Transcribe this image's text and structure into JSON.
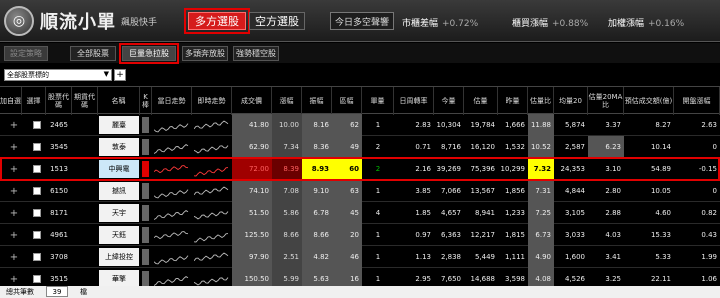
{
  "app": {
    "logo_text": "順流小單",
    "logo_sub": "飆股快手",
    "logo_icon": "logo-icon"
  },
  "modes": {
    "long": "多方選股",
    "short": "空方選股"
  },
  "today_button": "今日多空聲響",
  "market": [
    {
      "label": "市櫃差幅",
      "value": "+0.72%"
    },
    {
      "label": "櫃買漲幅",
      "value": "+0.88%"
    },
    {
      "label": "加權漲幅",
      "value": "+0.16%"
    }
  ],
  "tabs": {
    "settings": "設定策略",
    "all": "全部股票",
    "volume": "巨量急拉股",
    "rebound": "多頭奔放股",
    "weak": "強勢穩空股"
  },
  "filter": {
    "selected": "全部股票標的",
    "add": "+"
  },
  "columns": {
    "add": "加自選",
    "check": "選擇",
    "code": "股票代碼",
    "period": "期貨代碼",
    "name": "名稱",
    "bar": "K棒",
    "trend_daily": "當日走勢",
    "trend_recent": "即時走勢",
    "price": "成交價",
    "change": "漲幅",
    "amplitude": "振幅",
    "range": "區幅",
    "count": "單量",
    "turnover": "日周轉率",
    "vol_today": "今量",
    "vol_est": "估量",
    "vol_yday": "昨量",
    "ratio": "估量比",
    "ma20": "均量20",
    "ratio20": "估量20MA比",
    "deal_est": "預估成交額(億)",
    "open_change": "開盤漲幅"
  },
  "rows": [
    {
      "plus": "+",
      "code": "2465",
      "name": "麗臺",
      "price": "41.80",
      "change": "10.00",
      "amp": "8.16",
      "range": "62",
      "count": "1",
      "turnover": "2.83",
      "vol": "10,304",
      "est": "19,784",
      "yday": "1,666",
      "ratio": "11.88",
      "ma20": "5,874",
      "r20": "3.37",
      "deal": "8.27",
      "open": "2.63"
    },
    {
      "plus": "+",
      "code": "3545",
      "name": "敦泰",
      "price": "62.90",
      "change": "7.34",
      "amp": "8.36",
      "range": "49",
      "count": "2",
      "turnover": "0.71",
      "vol": "8,716",
      "est": "16,120",
      "yday": "1,532",
      "ratio": "10.52",
      "ma20": "2,587",
      "r20": "6.23",
      "deal": "10.14",
      "open": "0"
    },
    {
      "plus": "+",
      "code": "1513",
      "name": "中興電",
      "price": "72.00",
      "change": "8.39",
      "amp": "8.93",
      "range": "60",
      "count": "2",
      "turnover": "2.16",
      "vol": "39,269",
      "est": "75,396",
      "yday": "10,299",
      "ratio": "7.32",
      "ma20": "24,353",
      "r20": "3.10",
      "deal": "54.89",
      "open": "-0.15"
    },
    {
      "plus": "+",
      "code": "6150",
      "name": "撼訊",
      "price": "74.10",
      "change": "7.08",
      "amp": "9.10",
      "range": "63",
      "count": "1",
      "turnover": "3.85",
      "vol": "7,066",
      "est": "13,567",
      "yday": "1,856",
      "ratio": "7.31",
      "ma20": "4,844",
      "r20": "2.80",
      "deal": "10.05",
      "open": "0"
    },
    {
      "plus": "+",
      "code": "8171",
      "name": "天宇",
      "price": "51.50",
      "change": "5.86",
      "amp": "6.78",
      "range": "45",
      "count": "4",
      "turnover": "1.85",
      "vol": "4,657",
      "est": "8,941",
      "yday": "1,233",
      "ratio": "7.25",
      "ma20": "3,105",
      "r20": "2.88",
      "deal": "4.60",
      "open": "0.82"
    },
    {
      "plus": "+",
      "code": "4961",
      "name": "天鈺",
      "price": "125.50",
      "change": "8.66",
      "amp": "8.66",
      "range": "20",
      "count": "1",
      "turnover": "0.97",
      "vol": "6,363",
      "est": "12,217",
      "yday": "1,815",
      "ratio": "6.73",
      "ma20": "3,033",
      "r20": "4.03",
      "deal": "15.33",
      "open": "0.43"
    },
    {
      "plus": "+",
      "code": "3708",
      "name": "上緯投控",
      "price": "97.90",
      "change": "2.51",
      "amp": "4.82",
      "range": "46",
      "count": "1",
      "turnover": "1.13",
      "vol": "2,838",
      "est": "5,449",
      "yday": "1,111",
      "ratio": "4.90",
      "ma20": "1,600",
      "r20": "3.41",
      "deal": "5.33",
      "open": "1.99"
    },
    {
      "plus": "+",
      "code": "3515",
      "name": "華擎",
      "price": "150.50",
      "change": "5.99",
      "amp": "5.63",
      "range": "16",
      "count": "1",
      "turnover": "2.95",
      "vol": "7,650",
      "est": "14,688",
      "yday": "3,598",
      "ratio": "4.08",
      "ma20": "4,526",
      "r20": "3.25",
      "deal": "22.11",
      "open": "1.06"
    }
  ],
  "footer": {
    "label": "總共筆數",
    "count": "39",
    "unit": "檔"
  },
  "colors": {
    "accent": "#d51b1b",
    "highlight": "#ffff00",
    "up": "#00c000"
  }
}
